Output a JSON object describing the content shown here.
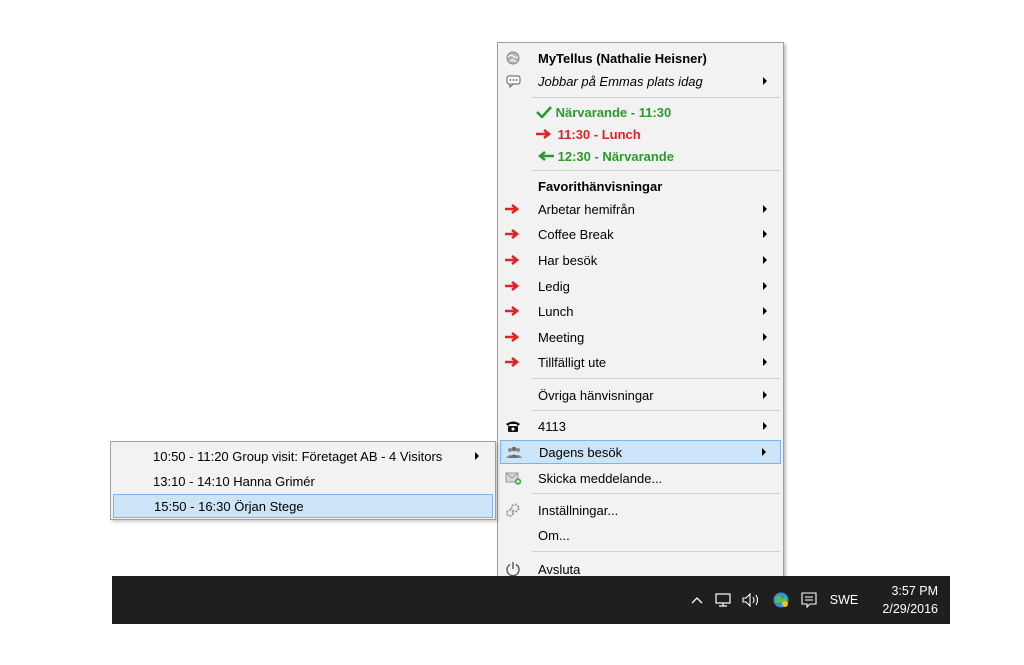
{
  "menu": {
    "title": "MyTellus (Nathalie Heisner)",
    "status_message": "Jobbar på Emmas plats idag",
    "schedule": [
      {
        "label": "Närvarande - 11:30",
        "color": "#2b9a2b"
      },
      {
        "label": "11:30 - Lunch",
        "color": "#e0222a"
      },
      {
        "label": "12:30 - Närvarande",
        "color": "#2b9a2b"
      }
    ],
    "favorites_header": "Favorithänvisningar",
    "favorites": [
      {
        "label": "Arbetar hemifrån"
      },
      {
        "label": "Coffee Break"
      },
      {
        "label": "Har besök"
      },
      {
        "label": "Ledig"
      },
      {
        "label": "Lunch"
      },
      {
        "label": "Meeting"
      },
      {
        "label": "Tillfälligt ute"
      }
    ],
    "other_referrals": "Övriga hänvisningar",
    "phone_number": "4113",
    "todays_visits": "Dagens besök",
    "send_message": "Skicka meddelande...",
    "settings": "Inställningar...",
    "about": "Om...",
    "quit": "Avsluta"
  },
  "submenu": {
    "items": [
      {
        "label": "10:50 - 11:20 Group visit: Företaget AB - 4 Visitors",
        "has_submenu": true
      },
      {
        "label": "13:10 - 14:10 Hanna Grimér",
        "has_submenu": false
      },
      {
        "label": "15:50 - 16:30 Örjan Stege",
        "has_submenu": false,
        "selected": true
      }
    ]
  },
  "taskbar": {
    "language": "SWE",
    "time": "3:57 PM",
    "date": "2/29/2016"
  },
  "colors": {
    "highlight": "#cce4f7",
    "highlight_border": "#7eb4ea",
    "menu_bg": "#f2f2f2",
    "taskbar_bg": "#1f1f1f"
  }
}
